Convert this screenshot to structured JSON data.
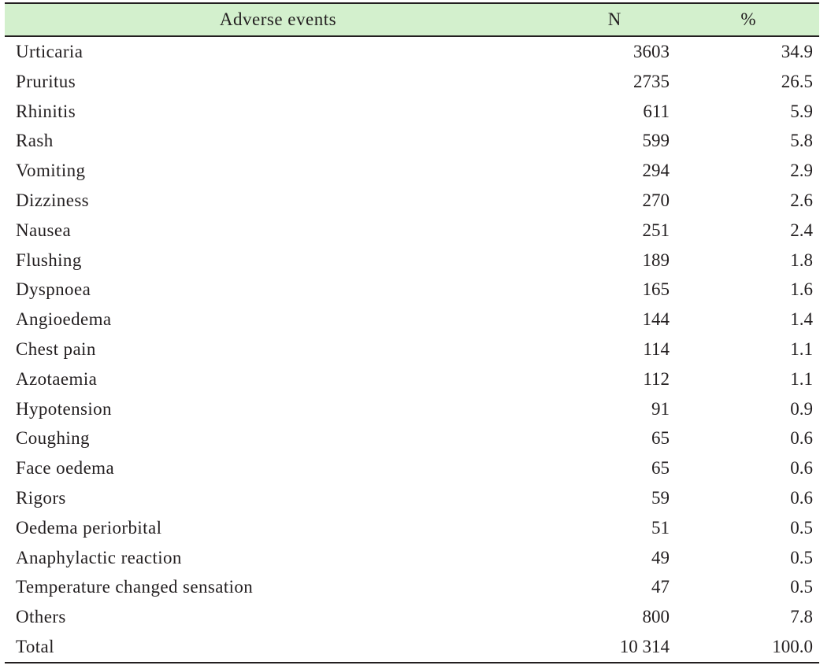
{
  "table": {
    "columns": [
      {
        "key": "event",
        "label": "Adverse events",
        "align": "center"
      },
      {
        "key": "n",
        "label": "N",
        "align": "center"
      },
      {
        "key": "pct",
        "label": "%",
        "align": "center"
      }
    ],
    "header_background": "#d3f0cd",
    "rule_color": "#231f20",
    "text_color": "#231f20",
    "rows": [
      {
        "event": "Urticaria",
        "n": "3603",
        "pct": "34.9"
      },
      {
        "event": "Pruritus",
        "n": "2735",
        "pct": "26.5"
      },
      {
        "event": "Rhinitis",
        "n": "611",
        "pct": "5.9"
      },
      {
        "event": "Rash",
        "n": "599",
        "pct": "5.8"
      },
      {
        "event": "Vomiting",
        "n": "294",
        "pct": "2.9"
      },
      {
        "event": "Dizziness",
        "n": "270",
        "pct": "2.6"
      },
      {
        "event": "Nausea",
        "n": "251",
        "pct": "2.4"
      },
      {
        "event": "Flushing",
        "n": "189",
        "pct": "1.8"
      },
      {
        "event": "Dyspnoea",
        "n": "165",
        "pct": "1.6"
      },
      {
        "event": "Angioedema",
        "n": "144",
        "pct": "1.4"
      },
      {
        "event": "Chest pain",
        "n": "114",
        "pct": "1.1"
      },
      {
        "event": "Azotaemia",
        "n": "112",
        "pct": "1.1"
      },
      {
        "event": "Hypotension",
        "n": "91",
        "pct": "0.9"
      },
      {
        "event": "Coughing",
        "n": "65",
        "pct": "0.6"
      },
      {
        "event": "Face oedema",
        "n": "65",
        "pct": "0.6"
      },
      {
        "event": "Rigors",
        "n": "59",
        "pct": "0.6"
      },
      {
        "event": "Oedema periorbital",
        "n": "51",
        "pct": "0.5"
      },
      {
        "event": "Anaphylactic reaction",
        "n": "49",
        "pct": "0.5"
      },
      {
        "event": "Temperature changed sensation",
        "n": "47",
        "pct": "0.5"
      },
      {
        "event": "Others",
        "n": "800",
        "pct": "7.8"
      },
      {
        "event": "Total",
        "n": "10 314",
        "pct": "100.0"
      }
    ]
  }
}
